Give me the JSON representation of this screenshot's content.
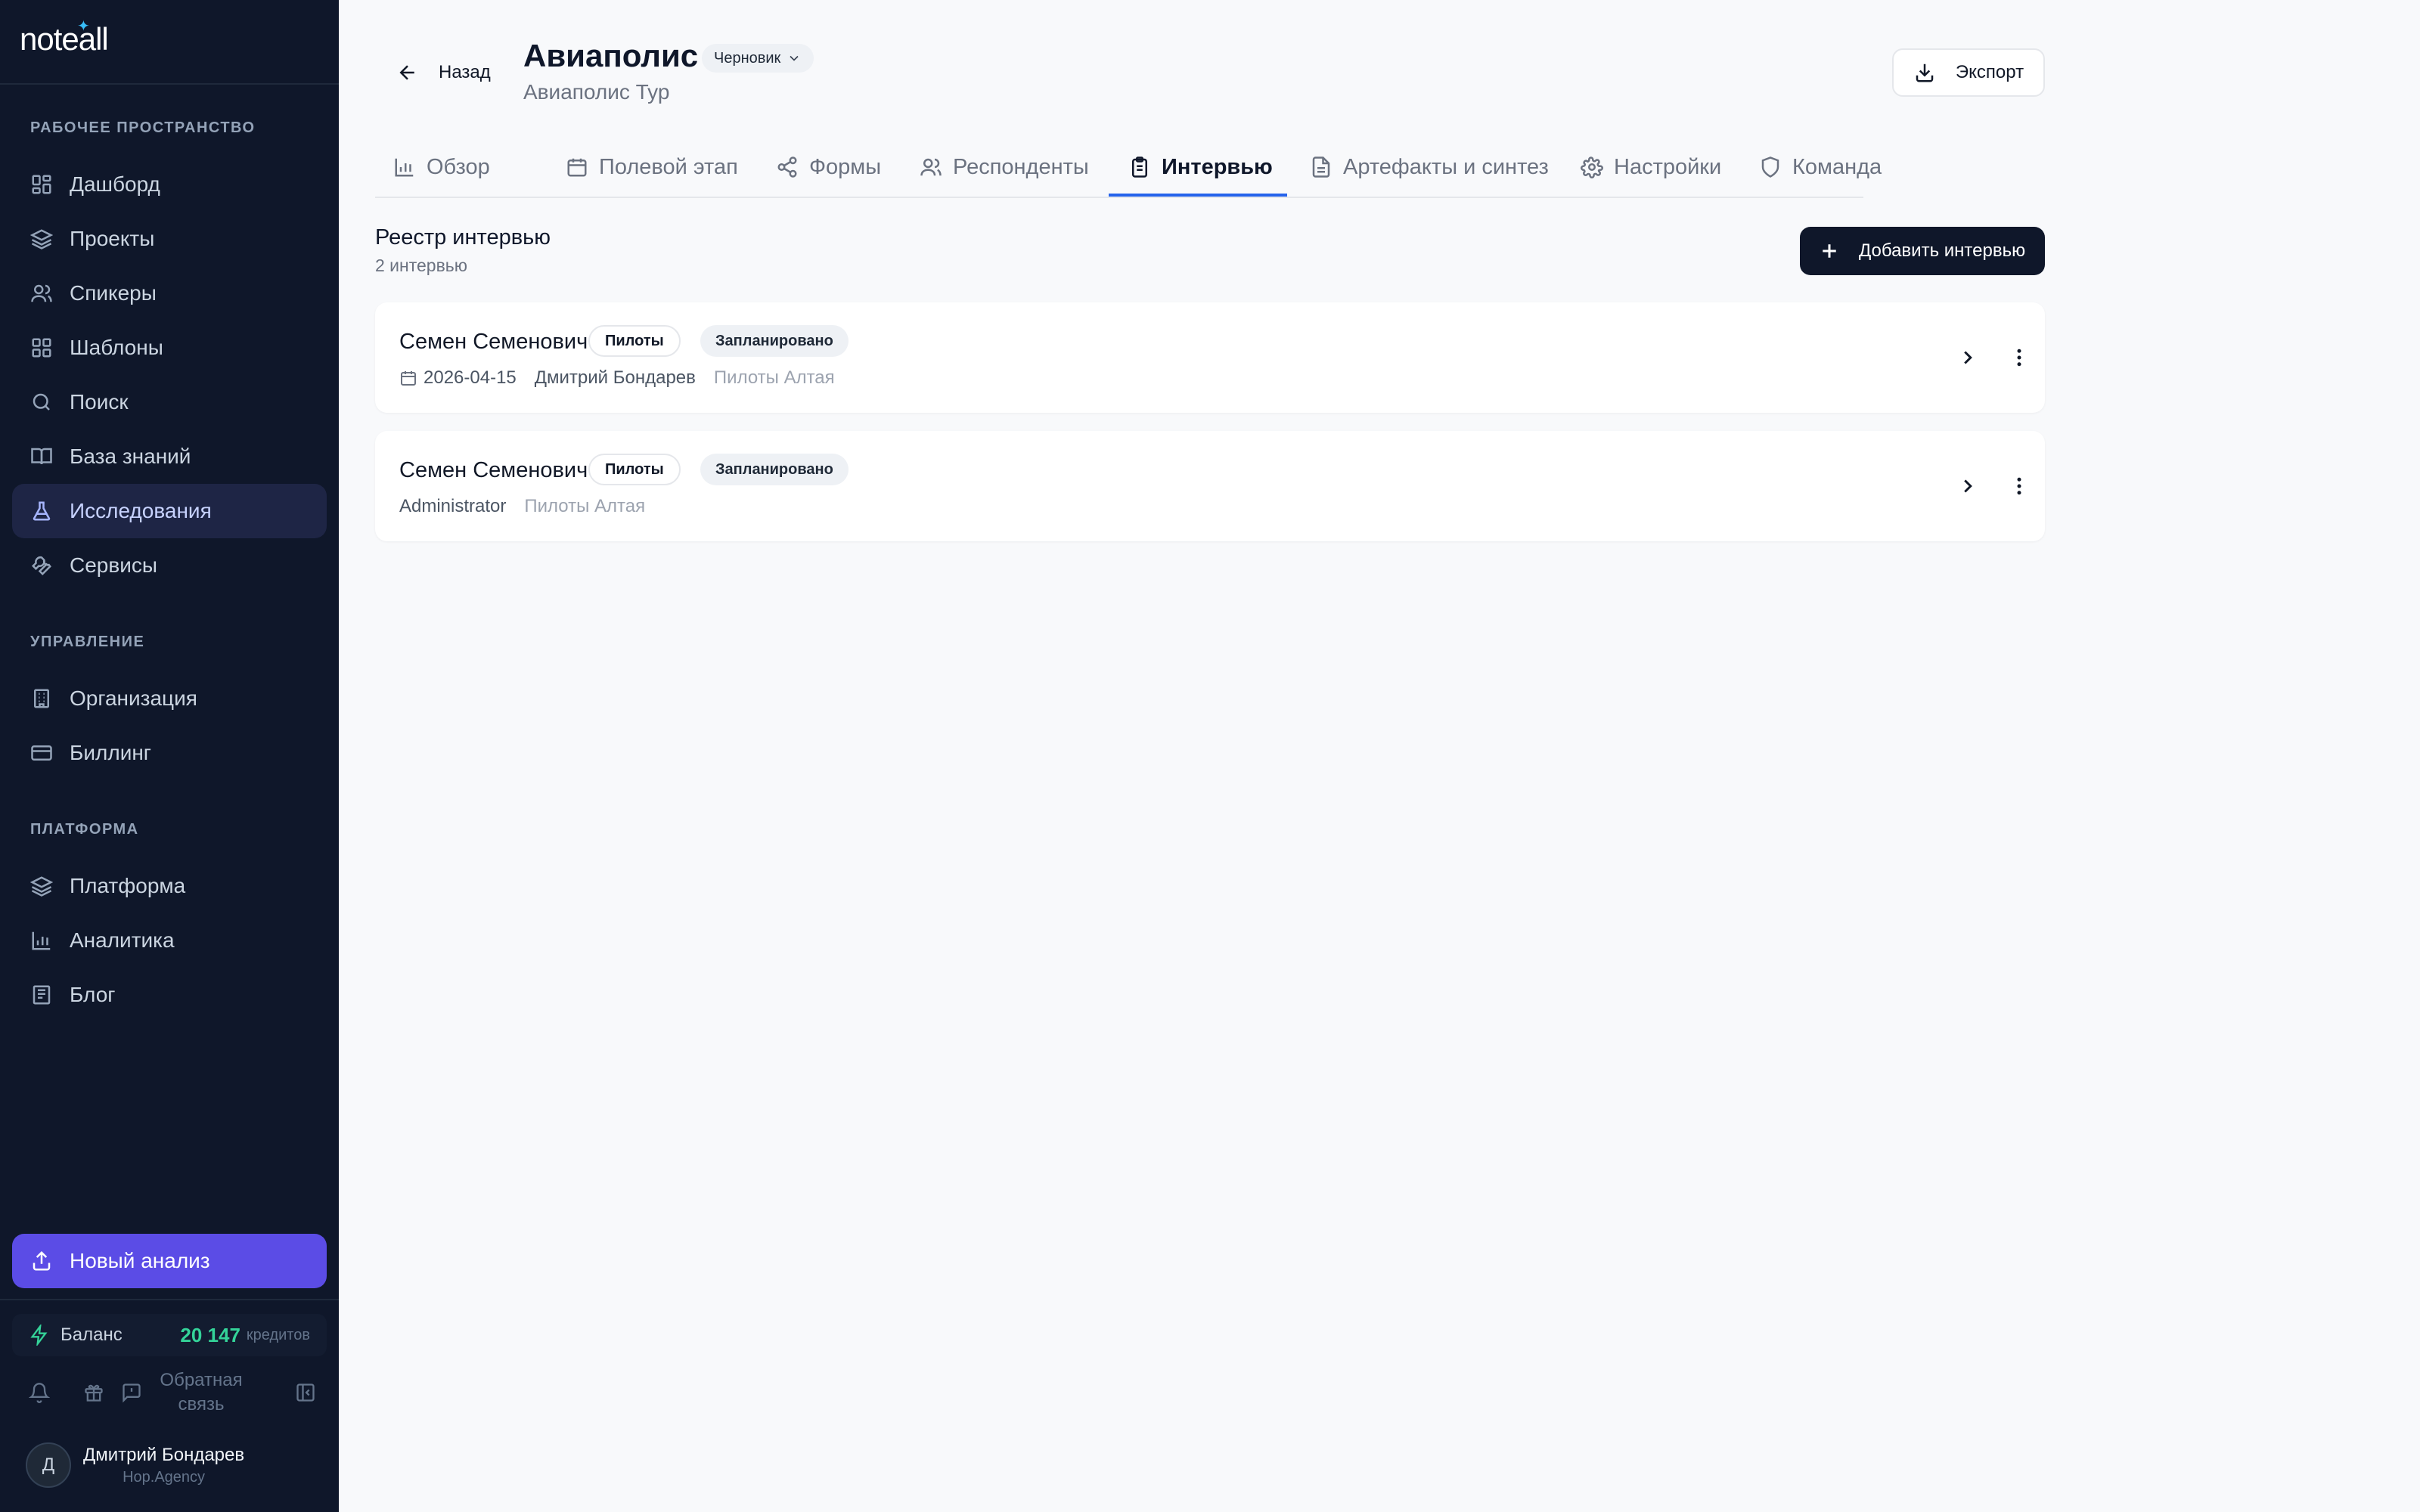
{
  "brand": {
    "logo": "noteall"
  },
  "sidebar": {
    "sections": {
      "workspace": "РАБОЧЕЕ ПРОСТРАНСТВО",
      "management": "УПРАВЛЕНИЕ",
      "platform": "ПЛАТФОРМА"
    },
    "workspace_items": [
      {
        "label": "Дашборд",
        "icon": "dashboard-icon"
      },
      {
        "label": "Проекты",
        "icon": "layers-icon"
      },
      {
        "label": "Спикеры",
        "icon": "users-icon"
      },
      {
        "label": "Шаблоны",
        "icon": "templates-icon"
      },
      {
        "label": "Поиск",
        "icon": "search-icon"
      },
      {
        "label": "База знаний",
        "icon": "book-icon"
      },
      {
        "label": "Исследования",
        "icon": "flask-icon",
        "active": true
      },
      {
        "label": "Сервисы",
        "icon": "wrench-icon"
      }
    ],
    "management_items": [
      {
        "label": "Организация",
        "icon": "building-icon"
      },
      {
        "label": "Биллинг",
        "icon": "card-icon"
      }
    ],
    "platform_items": [
      {
        "label": "Платформа",
        "icon": "layers-icon"
      },
      {
        "label": "Аналитика",
        "icon": "bar-chart-icon"
      },
      {
        "label": "Блог",
        "icon": "newspaper-icon"
      }
    ],
    "new_analysis": "Новый анализ",
    "balance": {
      "label": "Баланс",
      "amount": "20 147",
      "unit": "кредитов"
    },
    "feedback": "Обратная связь",
    "user": {
      "initial": "Д",
      "name": "Дмитрий Бондарев",
      "org": "Hop.Agency"
    }
  },
  "header": {
    "back_label": "Назад",
    "title": "Авиаполис",
    "status": "Черновик",
    "subtitle": "Авиаполис Тур",
    "export_label": "Экспорт"
  },
  "tabs": [
    {
      "label": "Обзор",
      "icon": "bar-chart-icon"
    },
    {
      "label": "Полевой этап",
      "icon": "calendar-icon"
    },
    {
      "label": "Формы",
      "icon": "share-icon"
    },
    {
      "label": "Респонденты",
      "icon": "users-icon"
    },
    {
      "label": "Интервью",
      "icon": "clipboard-icon",
      "active": true
    },
    {
      "label": "Артефакты и синтез",
      "icon": "file-icon"
    },
    {
      "label": "Настройки",
      "icon": "gear-icon"
    },
    {
      "label": "Команда",
      "icon": "shield-icon"
    }
  ],
  "registry": {
    "title": "Реестр интервью",
    "count": "2 интервью",
    "add_label": "Добавить интервью",
    "items": [
      {
        "name": "Семен Семенович",
        "role": "Пилоты",
        "status": "Запланировано",
        "date": "2026-04-15",
        "owner": "Дмитрий Бондарев",
        "group": "Пилоты Алтая"
      },
      {
        "name": "Семен Семенович",
        "role": "Пилоты",
        "status": "Запланировано",
        "owner": "Administrator",
        "group": "Пилоты Алтая"
      }
    ]
  },
  "colors": {
    "sidebar_bg": "#0f172a",
    "accent": "#5b4ce6",
    "tab_active": "#2563eb",
    "balance": "#34d399"
  }
}
